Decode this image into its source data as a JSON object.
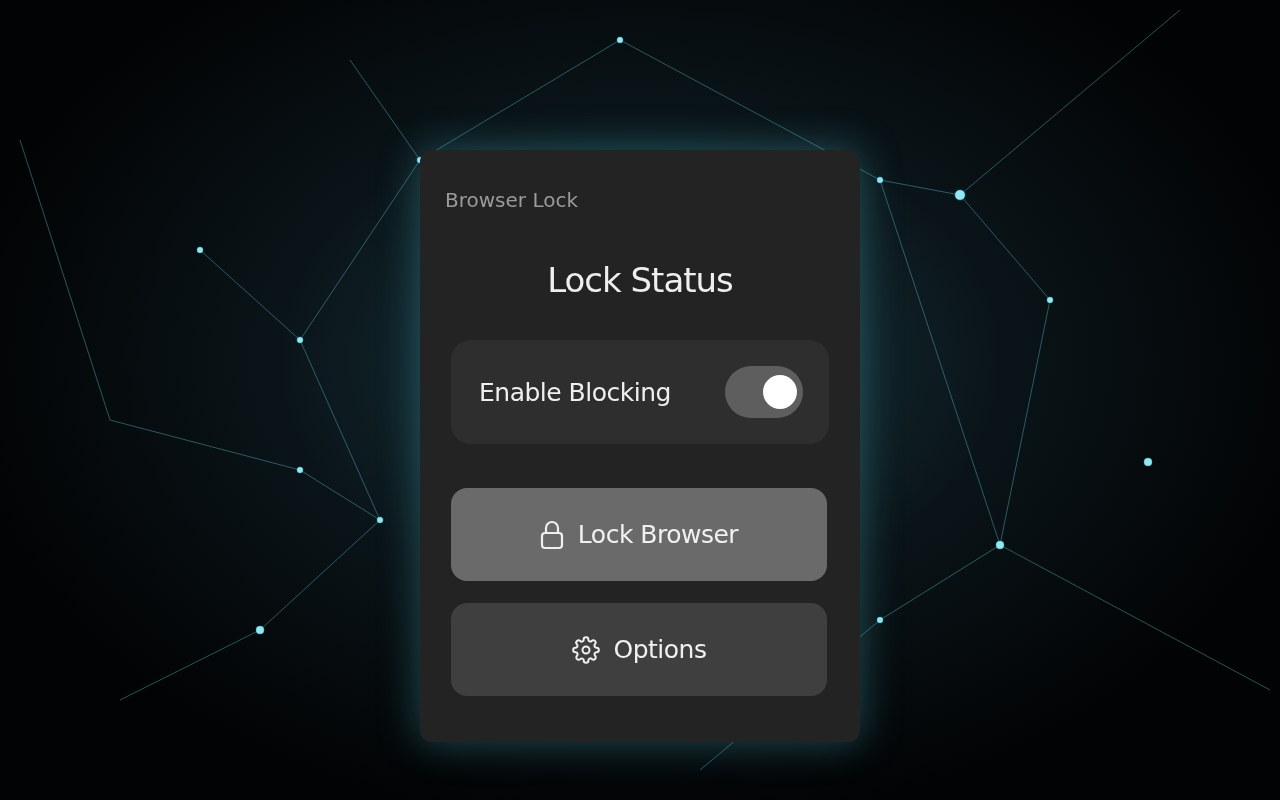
{
  "popup": {
    "app_name": "Browser Lock",
    "heading": "Lock Status",
    "toggle": {
      "label": "Enable Blocking",
      "on": true
    },
    "buttons": [
      {
        "label": "Lock Browser",
        "kind": "lock"
      },
      {
        "label": "Options",
        "kind": "options"
      }
    ]
  }
}
